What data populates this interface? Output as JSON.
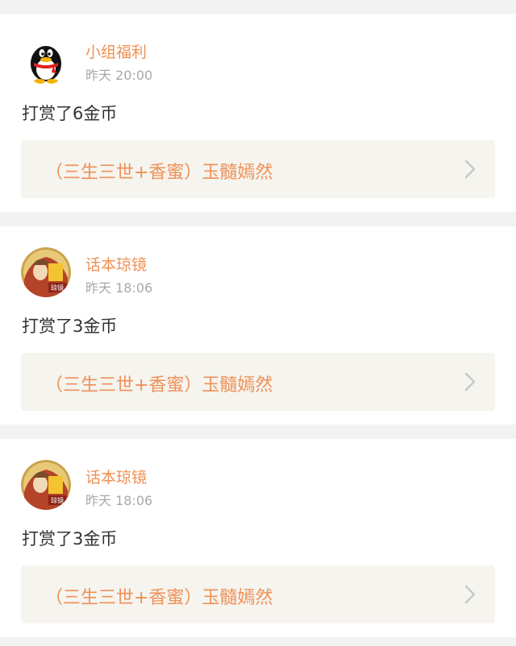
{
  "feed": {
    "items": [
      {
        "user": "小组福利",
        "avatar_icon": "qq-penguin-avatar",
        "time": "昨天 20:00",
        "message": "打赏了6金币",
        "book_title": "（三生三世+香蜜）玉髓嫣然"
      },
      {
        "user": "话本琼镜",
        "avatar_icon": "user-avatar",
        "time": "昨天 18:06",
        "message": "打赏了3金币",
        "book_title": "（三生三世+香蜜）玉髓嫣然"
      },
      {
        "user": "话本琼镜",
        "avatar_icon": "user-avatar",
        "time": "昨天 18:06",
        "message": "打赏了3金币",
        "book_title": "（三生三世+香蜜）玉髓嫣然"
      }
    ]
  },
  "colors": {
    "accent": "#ef8f52",
    "text": "#333333",
    "muted": "#a8a8a8",
    "link_bg": "#f5f4ee",
    "divider_bg": "#f2f2f2"
  }
}
